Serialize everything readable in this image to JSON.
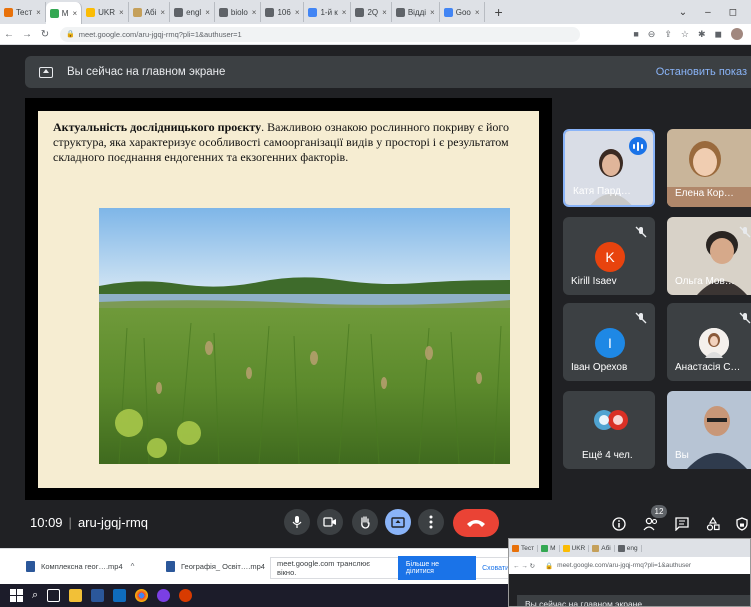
{
  "browser": {
    "tabs": [
      {
        "label": "Tecт",
        "color": "#e8710a"
      },
      {
        "label": "M",
        "color": "#34a853",
        "active": true
      },
      {
        "label": "UKR",
        "color": "#fbbc04"
      },
      {
        "label": "Абі",
        "color": "#c5a05a"
      },
      {
        "label": "engl",
        "color": "#5f6368"
      },
      {
        "label": "biolo",
        "color": "#5f6368"
      },
      {
        "label": "106",
        "color": "#5f6368"
      },
      {
        "label": "1-й к",
        "color": "#4285f4"
      },
      {
        "label": "2Q",
        "color": "#5f6368"
      },
      {
        "label": "Відді",
        "color": "#5f6368"
      },
      {
        "label": "Goo",
        "color": "#4285f4"
      }
    ],
    "new_tab": "+",
    "close_glyph": "×",
    "url": "meet.google.com/aru-jgqj-rmq?pli=1&authuser=1",
    "window_controls": [
      "⌄",
      "–",
      "◻"
    ]
  },
  "meet": {
    "banner_text": "Вы сейчас на главном экране",
    "stop_label": "Остановить показ",
    "slide": {
      "heading": "Актуальність дослідницького проєкту",
      "body": ". Важливою ознакою рослинного покриву є його структура, яка характеризує особливості самоорганізації видів у просторі і є результатом складного поєднання ендогенних та екзогенних факторів."
    },
    "participants": [
      {
        "name": "Катя Пард…",
        "type": "video",
        "speaking": true
      },
      {
        "name": "Елена Кор…",
        "type": "video"
      },
      {
        "name": "Kirill Isaev",
        "type": "avatar",
        "initial": "K",
        "color": "#e8430e"
      },
      {
        "name": "Ольга Мов…",
        "type": "video"
      },
      {
        "name": "Іван Орехов",
        "type": "avatar",
        "initial": "I",
        "color": "#1e88e5"
      },
      {
        "name": "Анастасія С…",
        "type": "photo-avatar"
      },
      {
        "name": "Ещё 4 чел.",
        "type": "more"
      },
      {
        "name": "Вы",
        "type": "video"
      }
    ],
    "meeting_time": "10:09",
    "meeting_code": "aru-jgqj-rmq",
    "participant_count": "12"
  },
  "downloads": [
    {
      "name": "Комплексна геог….mp4"
    },
    {
      "name": "Географія_ Освіт….mp4"
    }
  ],
  "share_notice": {
    "text": "meet.google.com транслює вікно.",
    "stop_btn": "Більше не ділитися",
    "hide_btn": "Сховати"
  },
  "mini_window": {
    "tabs": [
      "Tecт",
      "M",
      "UKR",
      "Абі",
      "eng"
    ],
    "url": "meet.google.com/aru-jgqj-rmq?pli=1&authuser",
    "banner": "Вы сейчас на главном экране"
  }
}
